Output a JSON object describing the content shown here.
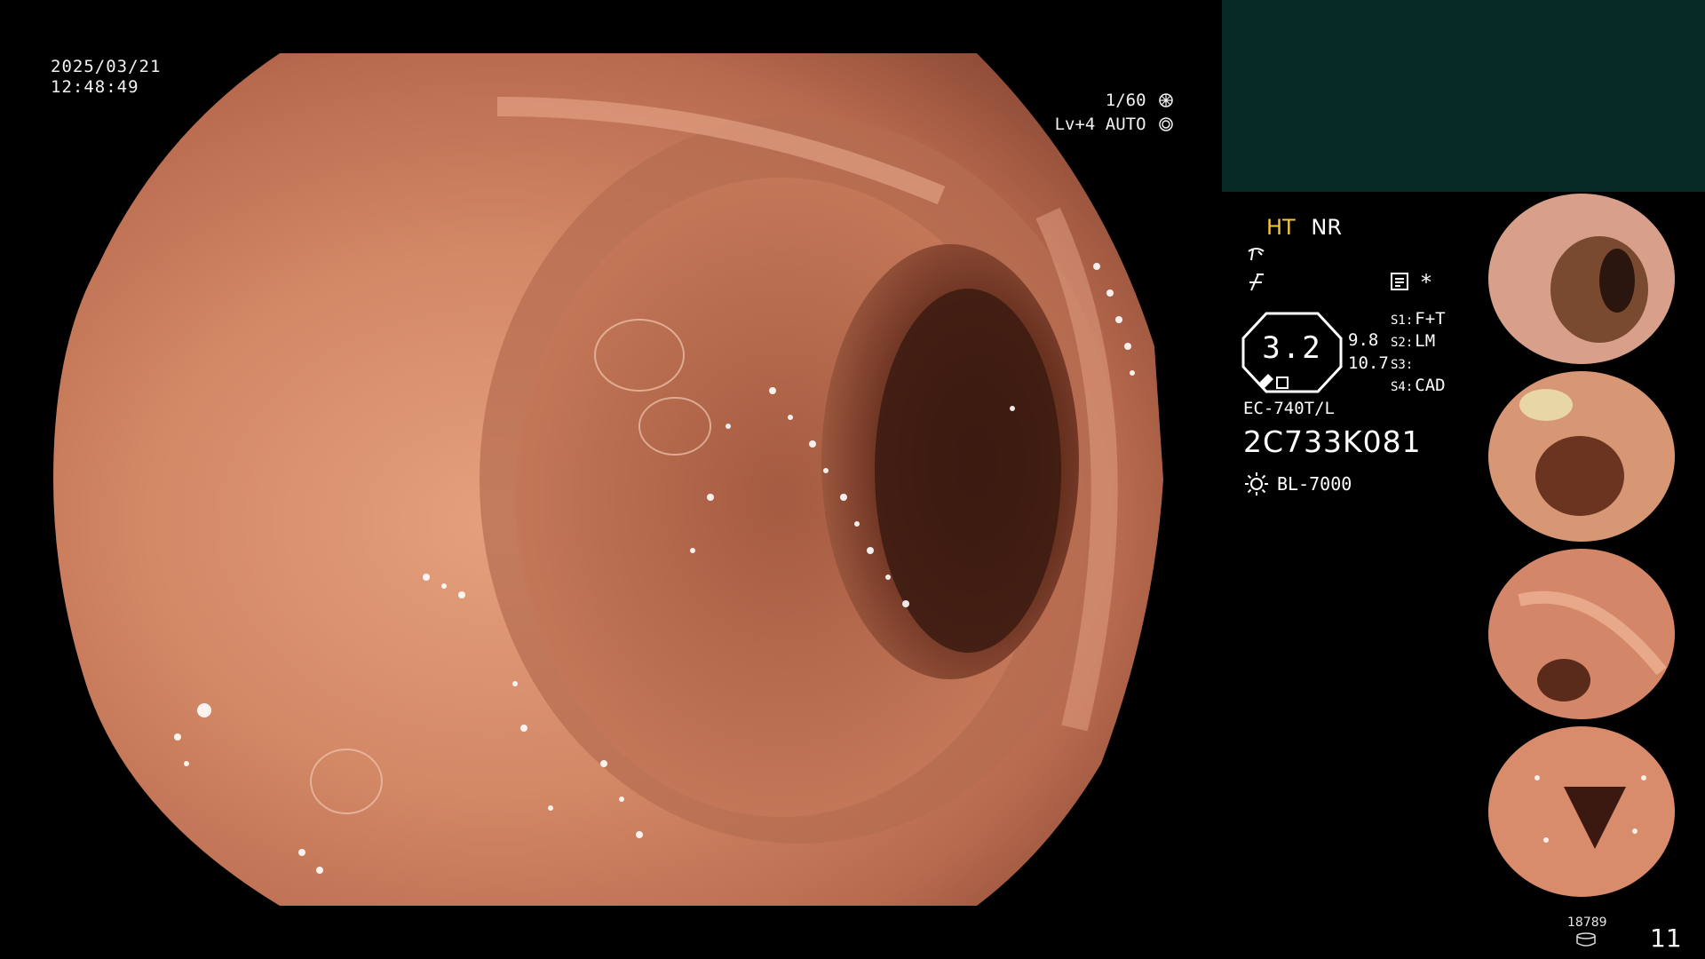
{
  "overlay": {
    "date": "2025/03/21",
    "time": "12:48:49",
    "shutter": "1/60",
    "iris_level": "Lv+4",
    "iris_mode": "AUTO",
    "shutter_icon": "aperture-icon",
    "iris_icon": "iris-icon"
  },
  "status": {
    "mode_ht": "HT",
    "mode_nr": "NR",
    "zoom_value": "3.2",
    "zoom_scale_a": "9.8",
    "zoom_scale_b": "10.7",
    "asterisk": "*",
    "switches": [
      {
        "key": "S1:",
        "value": "F+T"
      },
      {
        "key": "S2:",
        "value": "LM"
      },
      {
        "key": "S3:",
        "value": ""
      },
      {
        "key": "S4:",
        "value": "CAD"
      }
    ],
    "scope_model": "EC-740T/L",
    "scope_serial": "2C733K081",
    "light_source": "BL-7000"
  },
  "colors": {
    "accent_ht": "#f5c63a",
    "monitor_panel": "#062a26",
    "tissue": "#c87458"
  },
  "footer": {
    "image_count_small": "18789",
    "image_count": "11"
  }
}
